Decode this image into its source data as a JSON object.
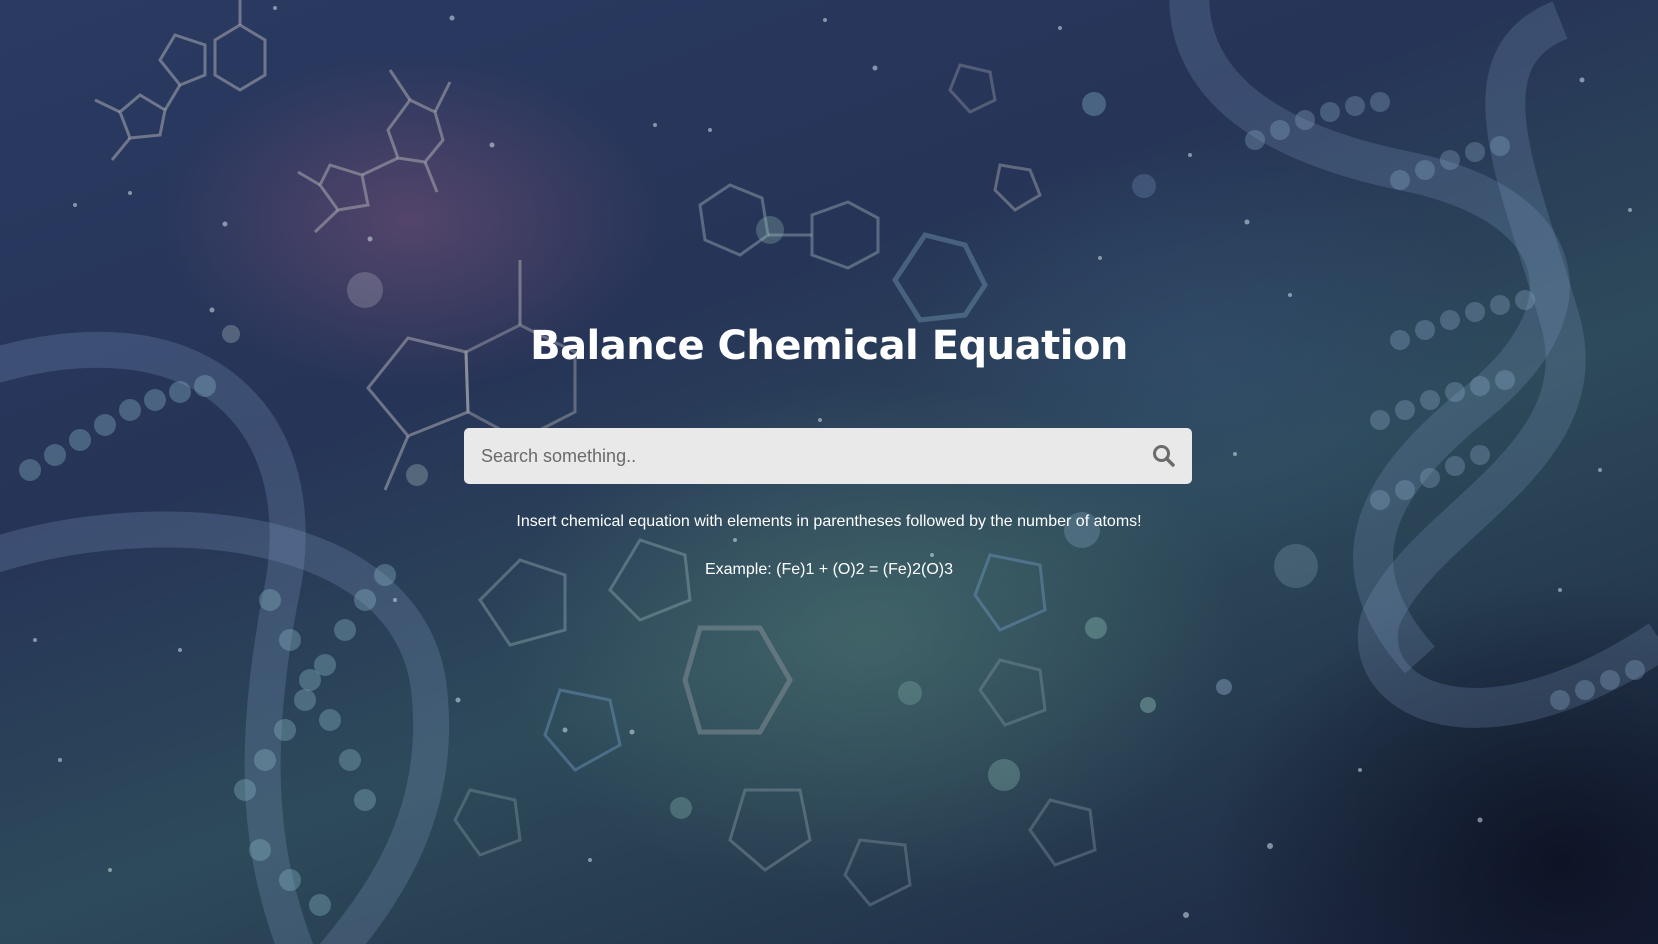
{
  "page": {
    "title": "Balance Chemical Equation"
  },
  "search": {
    "placeholder": "Search something..",
    "value": "",
    "button_icon": "search-icon"
  },
  "instructions": {
    "line1": "Insert chemical equation with elements in parentheses followed by the number of atoms!",
    "line2": "Example: (Fe)1 + (O)2 = (Fe)2(O)3"
  },
  "colors": {
    "title": "#ffffff",
    "search_bg": "#e9e9e9",
    "search_icon": "#6b6b6b"
  }
}
